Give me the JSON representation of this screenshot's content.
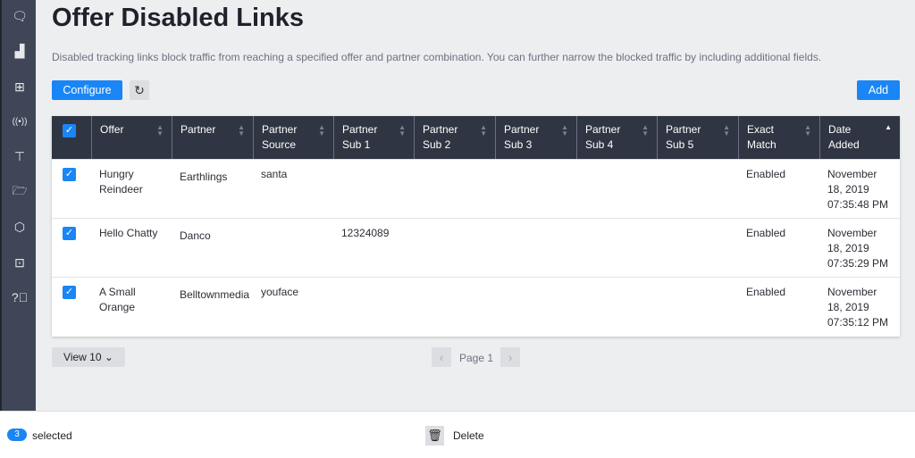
{
  "title": "Offer Disabled Links",
  "description": "Disabled tracking links block traffic from reaching a specified offer and partner combination. You can further narrow the blocked traffic by including additional fields.",
  "toolbar": {
    "configure": "Configure",
    "add": "Add"
  },
  "sidebar": [
    "chat-icon",
    "chart-icon",
    "hierarchy-icon",
    "broadcast-icon",
    "presentation-icon",
    "folder-icon",
    "hexagon-icon",
    "grid-icon",
    "help-icon"
  ],
  "columns": [
    "Offer",
    "Partner",
    "Partner Source",
    "Partner Sub 1",
    "Partner Sub 2",
    "Partner Sub 3",
    "Partner Sub 4",
    "Partner Sub 5",
    "Exact Match",
    "Date Added"
  ],
  "rows": [
    [
      "Hungry Reindeer",
      "Earthlings",
      "santa",
      "",
      "",
      "",
      "",
      "",
      "Enabled",
      "November 18, 2019 07:35:48 PM"
    ],
    [
      "Hello Chatty",
      "Danco",
      "",
      "12324089",
      "",
      "",
      "",
      "",
      "Enabled",
      "November 18, 2019 07:35:29 PM"
    ],
    [
      "A Small Orange",
      "Belltownmedia",
      "youface",
      "",
      "",
      "",
      "",
      "",
      "Enabled",
      "November 18, 2019 07:35:12 PM"
    ]
  ],
  "pagination": {
    "view": "View 10",
    "page": "Page 1"
  },
  "footer": {
    "count": "3",
    "selected": "selected",
    "delete": "Delete"
  },
  "colors": {
    "accent": "#1a86f5",
    "header": "#2f3542",
    "sidebar": "#3e4657"
  }
}
